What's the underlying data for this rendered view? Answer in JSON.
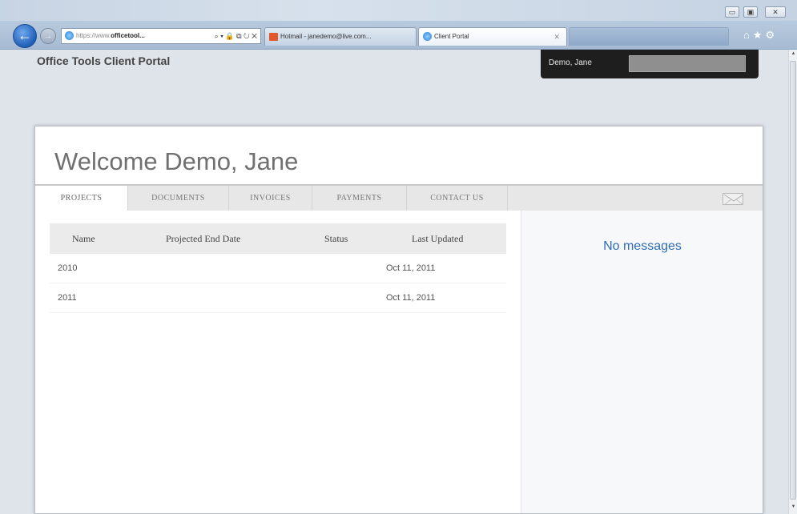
{
  "browser": {
    "address": {
      "prefix": "https://www.",
      "domain": "officetool...",
      "controls": "⌕ ▾ 🔒 ⧉ ↻ ✕"
    },
    "tabs": [
      {
        "title": "Hotmail - janedemo@live.com...",
        "close": ""
      },
      {
        "title": "Client Portal",
        "close": "✕"
      }
    ],
    "toolbar_icons": "⌂★⚙",
    "window_buttons": {
      "minimize": "▭",
      "maximize": "▣",
      "close": "✕"
    },
    "nav": {
      "back": "←",
      "forward": "→"
    }
  },
  "header": {
    "brand": "Office Tools Client Portal",
    "user_name": "Demo, Jane"
  },
  "main": {
    "welcome": "Welcome Demo, Jane",
    "tabs": [
      {
        "label": "PROJECTS",
        "active": true
      },
      {
        "label": "DOCUMENTS",
        "active": false
      },
      {
        "label": "INVOICES",
        "active": false
      },
      {
        "label": "PAYMENTS",
        "active": false
      },
      {
        "label": "CONTACT US",
        "active": false
      }
    ],
    "table": {
      "columns": [
        "Name",
        "Projected End Date",
        "Status",
        "Last Updated"
      ],
      "rows": [
        {
          "name": "2010",
          "projected_end": "",
          "status": "",
          "last_updated": "Oct 11, 2011"
        },
        {
          "name": "2011",
          "projected_end": "",
          "status": "",
          "last_updated": "Oct 11, 2011"
        }
      ]
    },
    "messages": {
      "empty_text": "No messages"
    }
  },
  "colors": {
    "link_blue": "#2f6cb5",
    "user_bar": "#1e1e1e",
    "page_bg": "#dfe4ea"
  }
}
